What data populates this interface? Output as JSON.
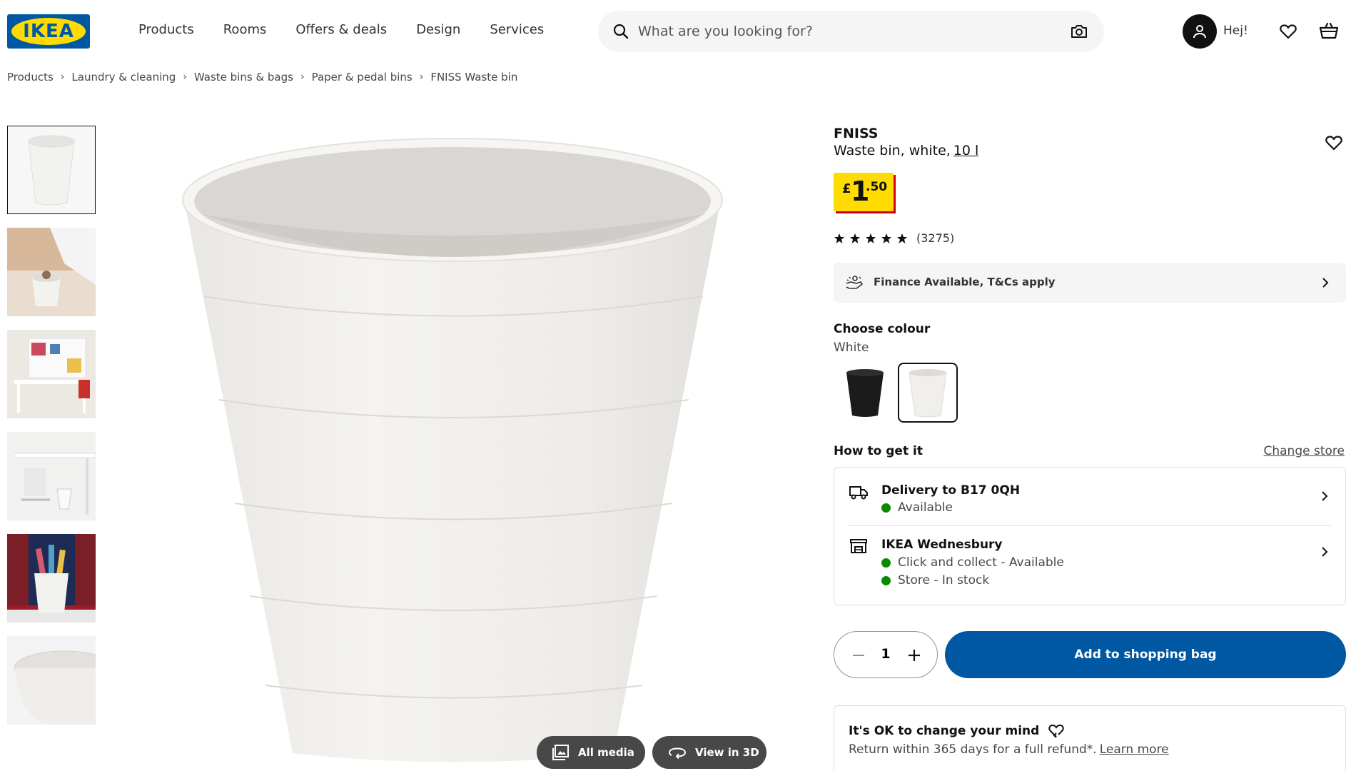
{
  "header": {
    "logo_text": "IKEA",
    "nav": [
      "Products",
      "Rooms",
      "Offers & deals",
      "Design",
      "Services"
    ],
    "search_placeholder": "What are you looking for?",
    "greeting": "Hej!"
  },
  "breadcrumb": [
    "Products",
    "Laundry & cleaning",
    "Waste bins & bags",
    "Paper & pedal bins",
    "FNISS Waste bin"
  ],
  "gallery": {
    "all_media_label": "All media",
    "view_3d_label": "View in 3D"
  },
  "product": {
    "name": "FNISS",
    "description": "Waste bin, white,",
    "size": "10 l",
    "price": {
      "currency": "£",
      "integer": "1",
      "decimal": ".50"
    },
    "rating": {
      "stars": 5,
      "count": "(3275)"
    },
    "finance_label": "Finance Available, T&Cs apply",
    "colour_label": "Choose colour",
    "colour_value": "White",
    "colours": [
      "Black",
      "White"
    ],
    "how_to_get_label": "How to get it",
    "change_store_label": "Change store",
    "delivery": {
      "title": "Delivery to B17 0QH",
      "status": "Available"
    },
    "store": {
      "title": "IKEA Wednesbury",
      "status1": "Click and collect - Available",
      "status2": "Store - In stock"
    },
    "quantity": "1",
    "add_to_bag_label": "Add to shopping bag",
    "refund": {
      "title": "It's OK to change your mind",
      "text": "Return within 365 days for a full refund*.",
      "link": "Learn more"
    }
  },
  "colors": {
    "ikea_blue": "#0058a3",
    "ikea_yellow": "#ffdb00",
    "price_shadow": "#cc0008",
    "available_green": "#0a8a00"
  }
}
